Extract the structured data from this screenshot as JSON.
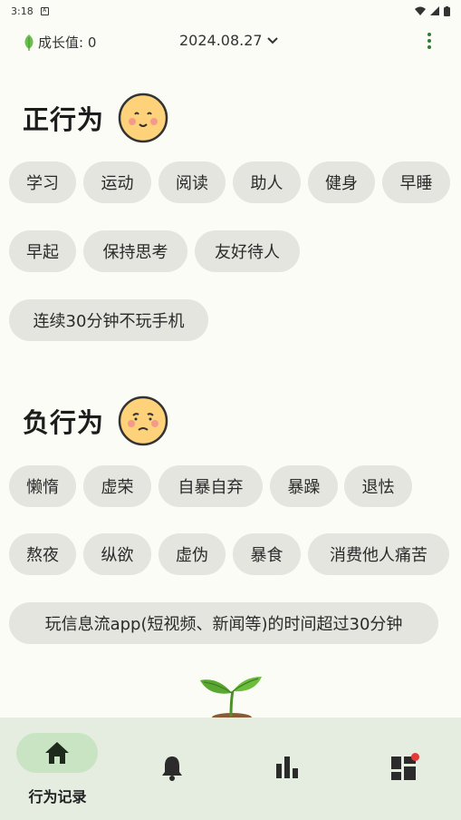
{
  "status_bar": {
    "time": "3:18",
    "notification_icon": "A"
  },
  "header": {
    "growth_label": "成长值: 0",
    "date": "2024.08.27",
    "icons": {
      "leaf": "leaf-icon",
      "chevron": "chevron-down-icon",
      "menu": "more-vert-icon"
    },
    "accent_color": "#2e7d32"
  },
  "positive": {
    "title": "正行为",
    "emoji": "smiling-face-icon",
    "chips": [
      "学习",
      "运动",
      "阅读",
      "助人",
      "健身",
      "早睡",
      "早起",
      "保持思考",
      "友好待人",
      "连续30分钟不玩手机"
    ]
  },
  "negative": {
    "title": "负行为",
    "emoji": "sad-face-icon",
    "chips": [
      "懒惰",
      "虚荣",
      "自暴自弃",
      "暴躁",
      "退怯",
      "熬夜",
      "纵欲",
      "虚伪",
      "暴食",
      "消费他人痛苦",
      "玩信息流app(短视频、新闻等)的时间超过30分钟"
    ]
  },
  "bottom_nav": {
    "items": [
      {
        "label": "行为记录",
        "icon": "home-icon",
        "selected": true
      },
      {
        "label": "",
        "icon": "bell-icon"
      },
      {
        "label": "",
        "icon": "bar-chart-icon"
      },
      {
        "label": "",
        "icon": "dashboard-icon",
        "badge": true
      }
    ],
    "badge_color": "#e53935"
  }
}
